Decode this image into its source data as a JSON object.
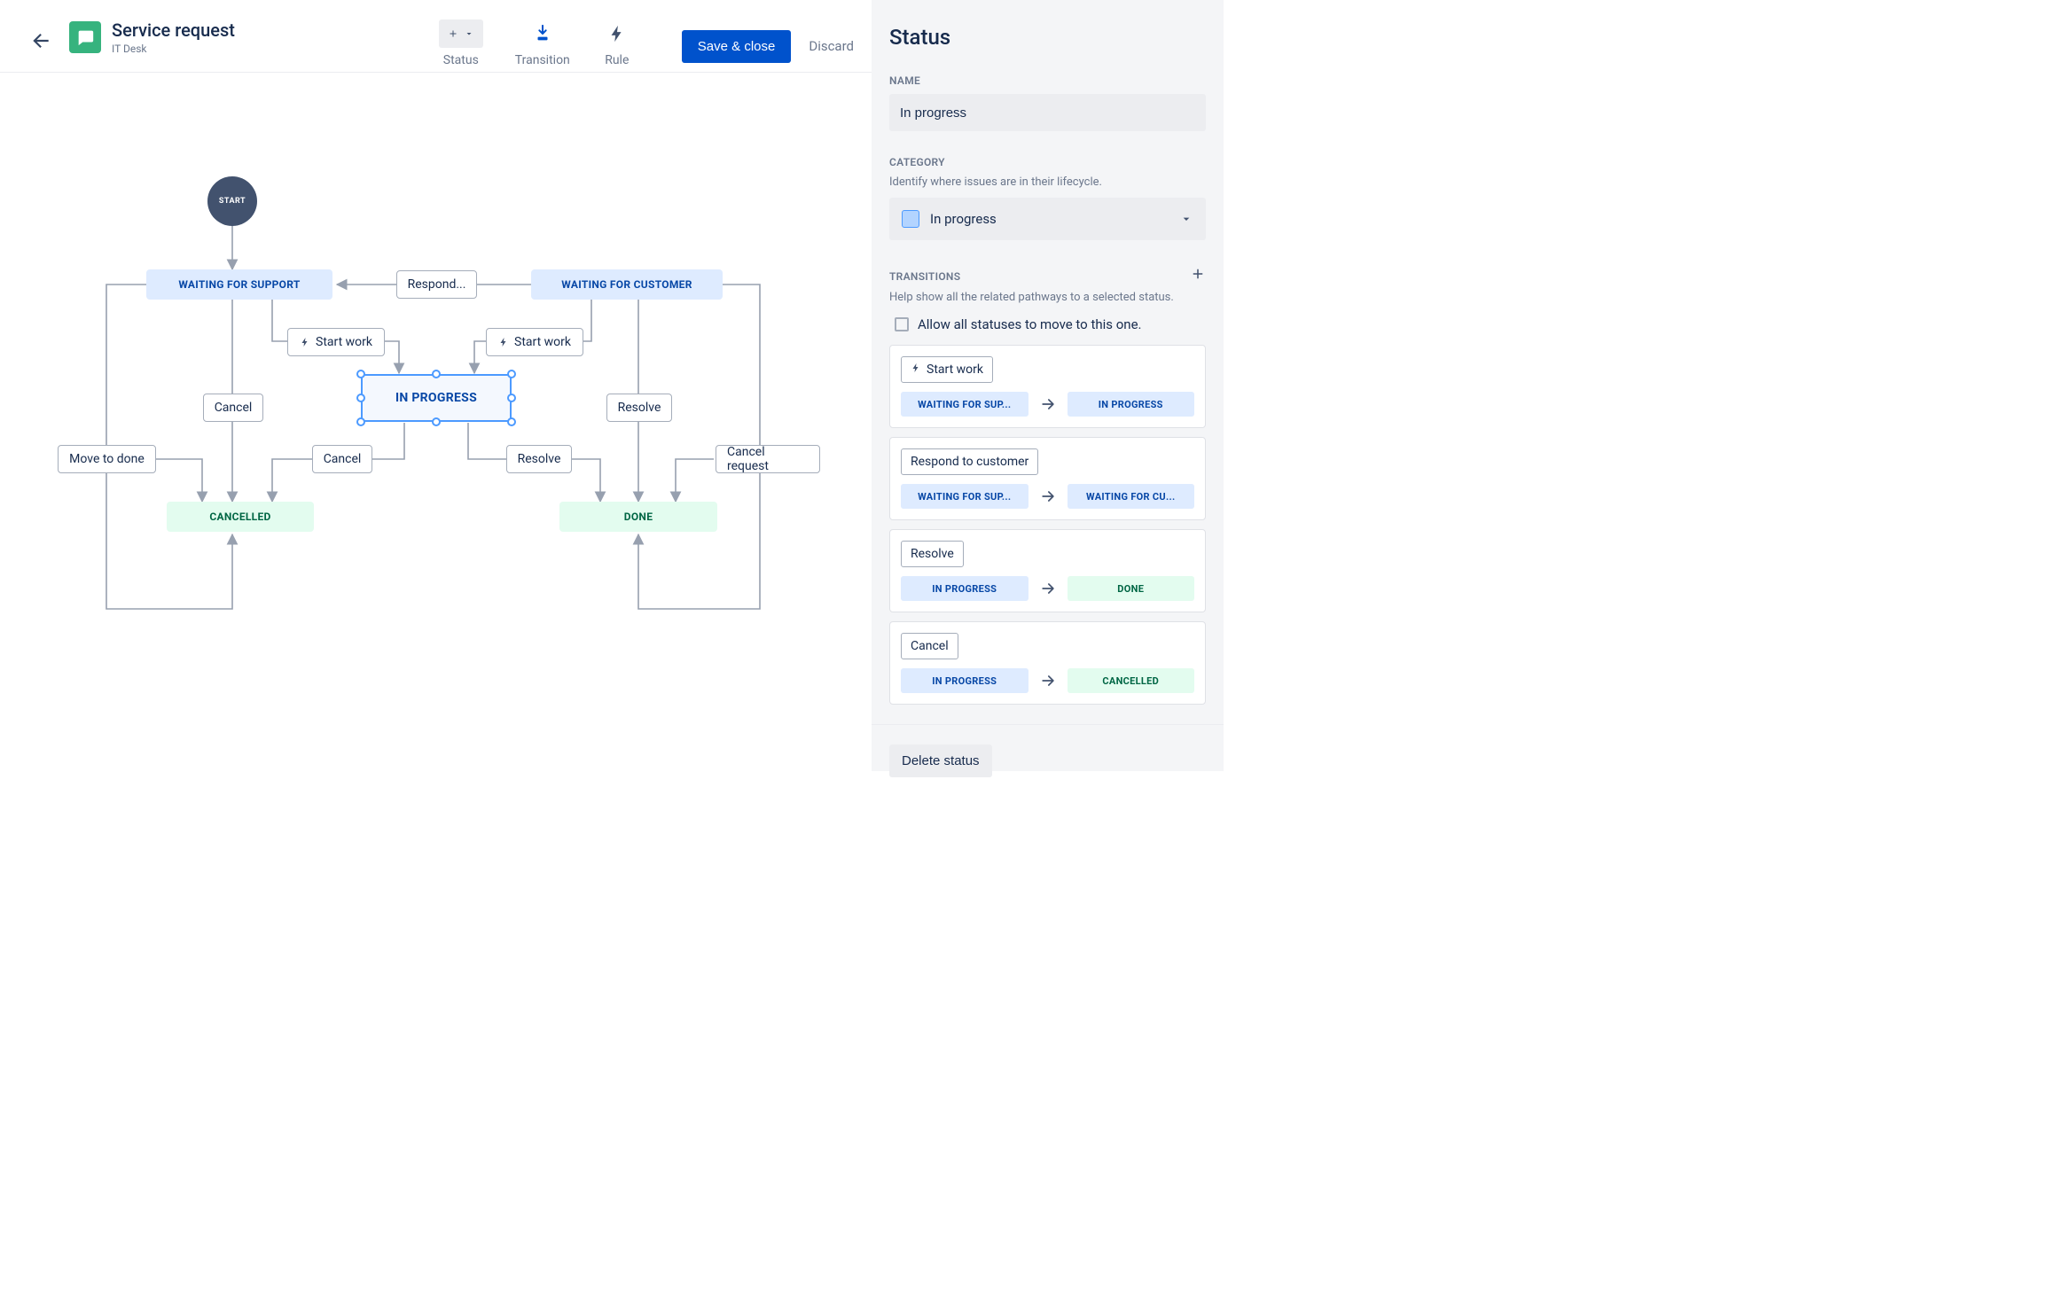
{
  "header": {
    "title": "Service request",
    "subtitle": "IT Desk",
    "tools": {
      "status_label": "Status",
      "transition_label": "Transition",
      "rule_label": "Rule"
    },
    "save_label": "Save & close",
    "discard_label": "Discard"
  },
  "workflow": {
    "start": "START",
    "nodes": {
      "waiting_support": "WAITING FOR SUPPORT",
      "waiting_customer": "WAITING FOR CUSTOMER",
      "in_progress": "IN PROGRESS",
      "cancelled": "CANCELLED",
      "done": "DONE"
    },
    "labels": {
      "respond": "Respond...",
      "start_work_1": "Start work",
      "start_work_2": "Start work",
      "cancel_1": "Cancel",
      "cancel_2": "Cancel",
      "resolve_1": "Resolve",
      "resolve_2": "Resolve",
      "move_to_done": "Move to done",
      "cancel_request": "Cancel request"
    }
  },
  "panel": {
    "title": "Status",
    "name_label": "NAME",
    "name_value": "In progress",
    "category_label": "CATEGORY",
    "category_help": "Identify where issues are in their lifecycle.",
    "category_value": "In progress",
    "transitions_label": "TRANSITIONS",
    "transitions_help": "Help show all the related pathways to a selected status.",
    "allow_all_label": "Allow all statuses to move to this one.",
    "transitions": [
      {
        "name": "Start work",
        "bolt": true,
        "from": "WAITING FOR SUP...",
        "to": "IN PROGRESS",
        "from_cat": "blue",
        "to_cat": "blue"
      },
      {
        "name": "Respond to customer",
        "bolt": false,
        "from": "WAITING FOR SUP...",
        "to": "WAITING FOR CU...",
        "from_cat": "blue",
        "to_cat": "blue"
      },
      {
        "name": "Resolve",
        "bolt": false,
        "from": "IN PROGRESS",
        "to": "DONE",
        "from_cat": "blue",
        "to_cat": "green"
      },
      {
        "name": "Cancel",
        "bolt": false,
        "from": "IN PROGRESS",
        "to": "CANCELLED",
        "from_cat": "blue",
        "to_cat": "green"
      }
    ],
    "delete_label": "Delete status"
  }
}
